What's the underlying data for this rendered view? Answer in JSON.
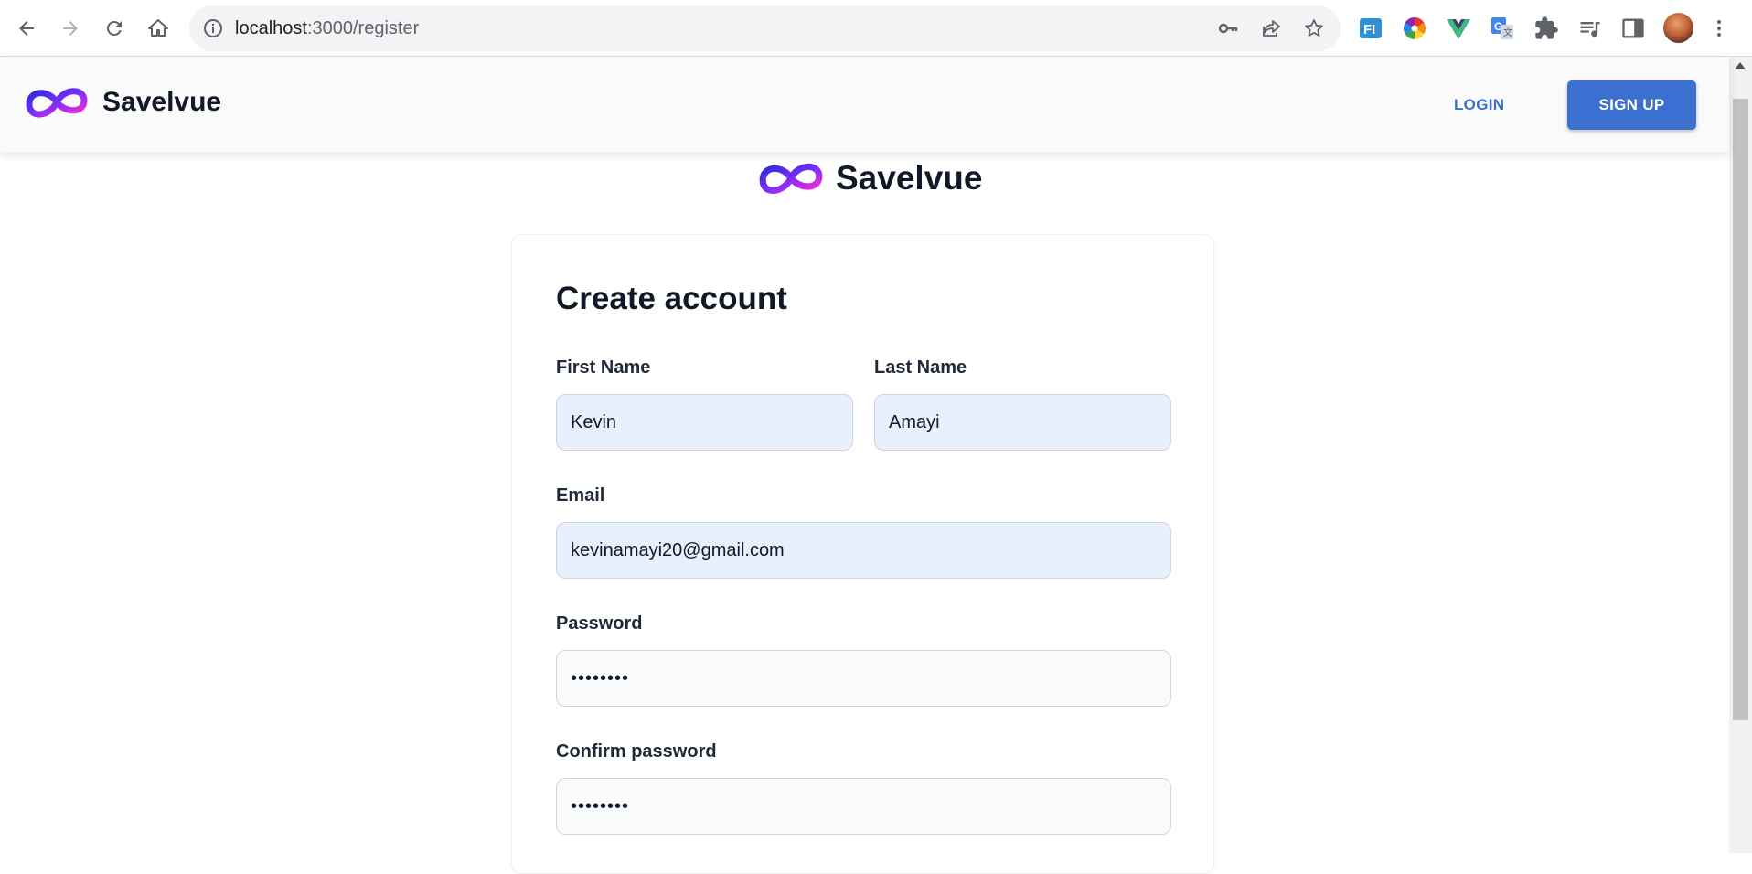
{
  "browser": {
    "url_host": "localhost",
    "url_path": ":3000/register"
  },
  "header": {
    "brand_name": "Savelvue",
    "login_label": "LOGIN",
    "signup_label": "SIGN UP"
  },
  "page": {
    "brand_name": "Savelvue"
  },
  "form": {
    "title": "Create account",
    "first_name": {
      "label": "First Name",
      "value": "Kevin"
    },
    "last_name": {
      "label": "Last Name",
      "value": "Amayi"
    },
    "email": {
      "label": "Email",
      "value": "kevinamayi20@gmail.com"
    },
    "password": {
      "label": "Password",
      "value": "••••••••"
    },
    "confirm_password": {
      "label": "Confirm password",
      "value": "••••••••"
    }
  },
  "colors": {
    "accent": "#3b6fd0",
    "autofill_bg": "#e8f0fe",
    "logo_primary": "#7b2ff7",
    "logo_secondary": "#ff2bd6"
  },
  "icons": [
    "back-icon",
    "forward-icon",
    "reload-icon",
    "home-icon",
    "info-icon",
    "key-icon",
    "share-icon",
    "star-icon",
    "extension-fi-icon",
    "color-wheel-icon",
    "vue-devtools-icon",
    "translate-icon",
    "puzzle-icon",
    "media-queue-icon",
    "side-panel-icon",
    "menu-dots-icon",
    "infinity-logo-icon"
  ]
}
